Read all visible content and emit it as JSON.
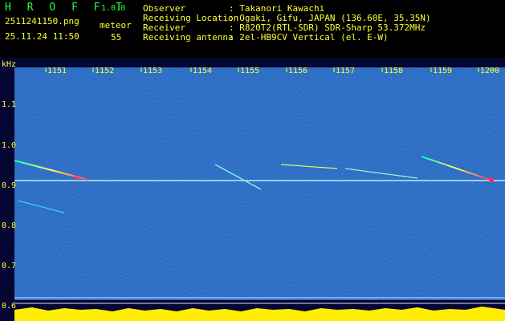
{
  "app": {
    "brand": "H R O F F T",
    "version": "1.0.0"
  },
  "image": {
    "filename": "2511241150.png",
    "datetime": "25.11.24 11:50",
    "type": "meteor",
    "count": "55"
  },
  "meta": [
    {
      "key": "Observer",
      "value": ": Takanori Kawachi"
    },
    {
      "key": "Receiving Location",
      "value": ": Ogaki, Gifu, JAPAN (136.60E, 35.35N)"
    },
    {
      "key": "Receiver",
      "value": ": R820T2(RTL-SDR) SDR-Sharp 53.372MHz"
    },
    {
      "key": "Receiving antenna",
      "value": ": 2el-HB9CV Vertical (el. E-W)"
    }
  ],
  "axis": {
    "unit": "kHz",
    "time_ticks": [
      "1151",
      "1152",
      "1153",
      "1154",
      "1155",
      "1156",
      "1157",
      "1158",
      "1159",
      "1200"
    ],
    "freq_ticks": [
      "1.1",
      "1.0",
      "0.9",
      "0.8",
      "0.7",
      "0.6"
    ]
  },
  "colors": {
    "bg": "#08083a",
    "accent": "#ffff33",
    "green": "#22ff44",
    "carrier": "#b0f0ff",
    "level": "#ffee00",
    "level_base": "#00c8ff"
  }
}
